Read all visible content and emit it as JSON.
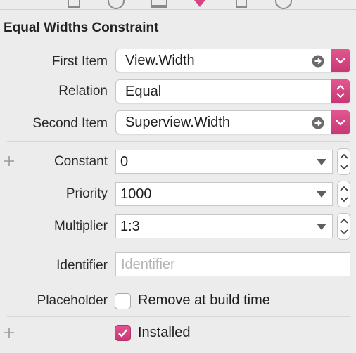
{
  "inspector": {
    "heading": "Equal Widths Constraint"
  },
  "first_item": {
    "label": "First Item",
    "value": "View.Width"
  },
  "relation": {
    "label": "Relation",
    "value": "Equal"
  },
  "second_item": {
    "label": "Second Item",
    "value": "Superview.Width"
  },
  "constant": {
    "label": "Constant",
    "value": "0"
  },
  "priority": {
    "label": "Priority",
    "value": "1000"
  },
  "multiplier": {
    "label": "Multiplier",
    "value": "1:3"
  },
  "identifier": {
    "label": "Identifier",
    "placeholder": "Identifier",
    "value": ""
  },
  "placeholder_row": {
    "label": "Placeholder",
    "checkbox_label": "Remove at build time",
    "checked": false
  },
  "installed": {
    "checkbox_label": "Installed",
    "checked": true
  },
  "colors": {
    "accent": "#d6457f",
    "background": "#ececec"
  },
  "icons": [
    "file-icon",
    "help-icon",
    "identity-icon",
    "attributes-icon",
    "size-icon",
    "connections-icon",
    "go-to-arrow-icon",
    "disclosure-chevron-icon",
    "popup-updown-icon",
    "combo-caret-icon",
    "stepper-icon",
    "plus-icon",
    "checkmark-icon"
  ]
}
